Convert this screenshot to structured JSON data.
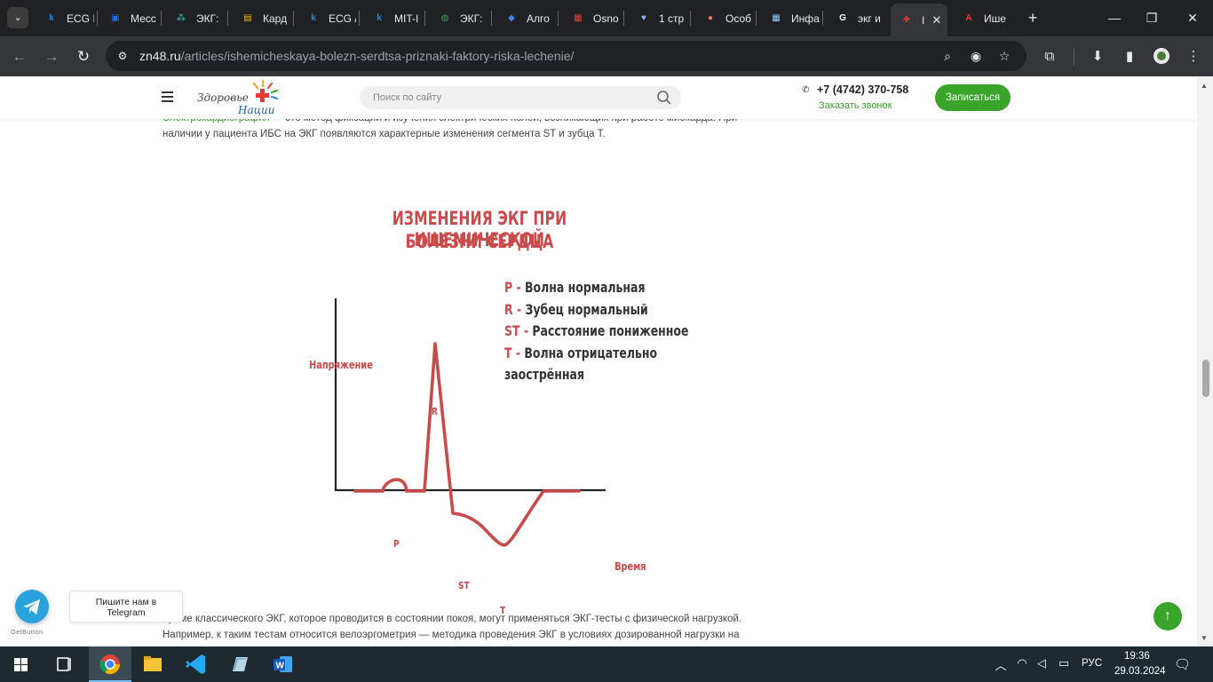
{
  "browser": {
    "tabs": [
      {
        "title": "ECG I",
        "icon": "k-letter-icon",
        "color": "#1e88e5"
      },
      {
        "title": "Месс",
        "icon": "chat-icon",
        "color": "#1a73e8"
      },
      {
        "title": "ЭКГ:",
        "icon": "molecule-icon",
        "color": "#26a69a"
      },
      {
        "title": "Кард",
        "icon": "picture-icon",
        "color": "#f4b400"
      },
      {
        "title": "ECG /",
        "icon": "k-letter-icon",
        "color": "#1e88e5"
      },
      {
        "title": "MIT-I",
        "icon": "k-letter-icon",
        "color": "#1e88e5"
      },
      {
        "title": "ЭКГ:",
        "icon": "globe-ring-icon",
        "color": "#34a853"
      },
      {
        "title": "Алго",
        "icon": "drop-icon",
        "color": "#4285f4"
      },
      {
        "title": "Osno",
        "icon": "image-doc-icon",
        "color": "#db4437"
      },
      {
        "title": "1 стр",
        "icon": "heart-icon",
        "color": "#8ab4f8"
      },
      {
        "title": "Особ",
        "icon": "circle-logo-icon",
        "color": "#e57373"
      },
      {
        "title": "Инфа",
        "icon": "grid-icon",
        "color": "#90caf9"
      },
      {
        "title": "экг и",
        "icon": "google-icon",
        "color": "#ffffff"
      },
      {
        "title": "I",
        "icon": "sun-cross-icon",
        "color": "#e53935",
        "active": true
      },
      {
        "title": "Ише",
        "icon": "ak-letters-icon",
        "color": "#e53935"
      }
    ],
    "url_host": "zn48.ru",
    "url_path": "/articles/ishemicheskaya-bolezn-serdtsa-priznaki-faktory-riska-lechenie/"
  },
  "site": {
    "logo_line1": "Здоровье",
    "logo_line2": "Нации",
    "search_placeholder": "Поиск по сайту",
    "phone": "+7 (4742) 370-758",
    "callback": "Заказать звонок",
    "signup": "Записаться"
  },
  "article": {
    "para1_link": "Электрокардиография",
    "para1_rest": " — это метод фиксации и изучения электрических полей, возникающих при работе миокарда. При",
    "para1_line2": "наличии у пациента ИБС на ЭКГ появляются характерные изменения сегмента ST и зубца Т.",
    "para2_line1": "Кроме классического ЭКГ, которое проводится в состоянии покоя, могут применяться ЭКГ-тесты с физической нагрузкой.",
    "para2_line2": "Например, к таким тестам относится велоэргометрия — методика проведения ЭКГ в условиях дозированной нагрузки на"
  },
  "infographic": {
    "title_line1": "ИЗМЕНЕНИЯ ЭКГ ПРИ ИШЕМИЧЕСКОЙ",
    "title_line2": "БОЛЕЗНИ СЕРДЦА",
    "y_axis": "Напряжение",
    "x_axis": "Время",
    "wave_labels": {
      "p": "P",
      "r": "R",
      "st": "ST",
      "t": "T"
    },
    "legend": [
      {
        "key": "P -",
        "text": " Волна нормальная"
      },
      {
        "key": "R -",
        "text": " Зубец нормальный"
      },
      {
        "key": "ST -",
        "text": " Расстояние пониженное"
      },
      {
        "key": "T -",
        "text": " Волна отрицательно"
      },
      {
        "key": "",
        "text": "заострённая"
      }
    ],
    "accent": "#c94a4a"
  },
  "widgets": {
    "telegram_tip_line1": "Пишите нам в",
    "telegram_tip_line2": "Telegram",
    "getbutton_brand": "GetButton"
  },
  "taskbar": {
    "lang": "РУС",
    "time": "19:36",
    "date": "29.03.2024"
  }
}
